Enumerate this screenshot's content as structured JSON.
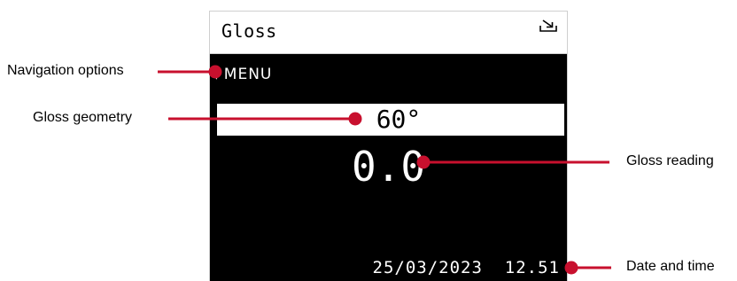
{
  "device": {
    "title": "Gloss",
    "export_icon": "export-tray-icon",
    "menu_arrow": "▼",
    "menu_label": "MENU",
    "geometry": "60°",
    "reading": "0.0",
    "datetime": "25/03/2023  12.51"
  },
  "callouts": {
    "navigation": "Navigation options",
    "geometry": "Gloss geometry",
    "reading": "Gloss reading",
    "datetime": "Date and time"
  },
  "colors": {
    "callout": "#c8102e",
    "screen": "#000000",
    "text_on_screen": "#ffffff"
  }
}
